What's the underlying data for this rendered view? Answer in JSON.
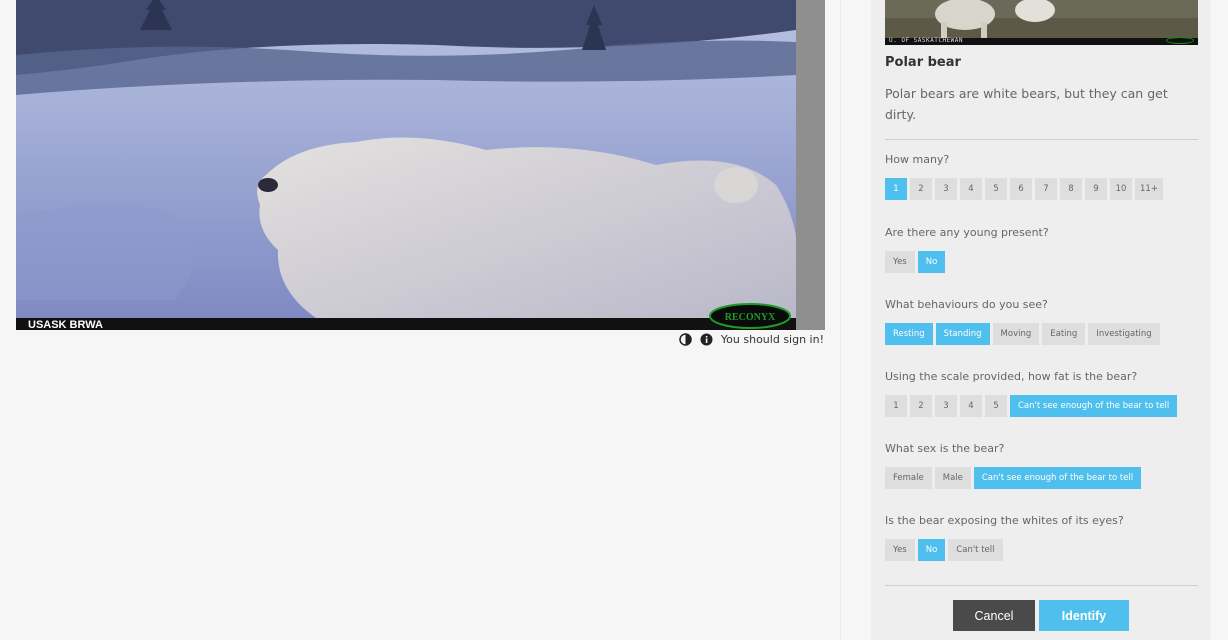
{
  "image": {
    "camera_label": "USASK BRWA",
    "camera_brand": "RECONYX"
  },
  "toolbar": {
    "contrast_icon": "contrast-icon",
    "info_icon": "info-icon",
    "signin_text": "You should sign in!"
  },
  "species": {
    "thumb_caption": "U. OF SASKATCHEWAN",
    "name": "Polar bear",
    "description": "Polar bears are white bears, but they can get dirty."
  },
  "questions": {
    "how_many": {
      "label": "How many?",
      "options": [
        "1",
        "2",
        "3",
        "4",
        "5",
        "6",
        "7",
        "8",
        "9",
        "10",
        "11+"
      ],
      "selected": "1"
    },
    "young": {
      "label": "Are there any young present?",
      "options": [
        "Yes",
        "No"
      ],
      "selected": "No"
    },
    "behaviours": {
      "label": "What behaviours do you see?",
      "options": [
        "Resting",
        "Standing",
        "Moving",
        "Eating",
        "Investigating"
      ],
      "selected": [
        "Resting",
        "Standing"
      ]
    },
    "fat": {
      "label": "Using the scale provided, how fat is the bear?",
      "options": [
        "1",
        "2",
        "3",
        "4",
        "5",
        "Can't see enough of the bear to tell"
      ],
      "selected": "Can't see enough of the bear to tell"
    },
    "sex": {
      "label": "What sex is the bear?",
      "options": [
        "Female",
        "Male",
        "Can't see enough of the bear to tell"
      ],
      "selected": "Can't see enough of the bear to tell"
    },
    "eyes": {
      "label": "Is the bear exposing the whites of its eyes?",
      "options": [
        "Yes",
        "No",
        "Can't tell"
      ],
      "selected": "No"
    }
  },
  "actions": {
    "cancel": "Cancel",
    "identify": "Identify"
  },
  "colors": {
    "accent": "#4fbfee",
    "button_dark": "#4a4a4a",
    "answer_bg": "#dedede"
  }
}
